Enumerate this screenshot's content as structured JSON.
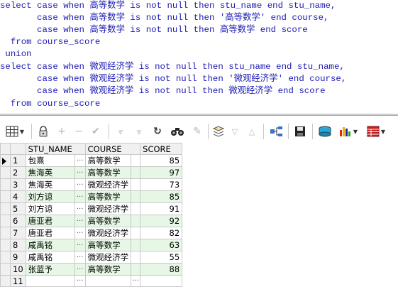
{
  "sql": {
    "lines": [
      [
        {
          "t": "select case when ",
          "c": "kw"
        },
        {
          "t": "高等数学",
          "c": "kw"
        },
        {
          "t": " is not null then ",
          "c": "kw"
        },
        {
          "t": "stu_name",
          "c": "kw"
        },
        {
          "t": " end ",
          "c": "kw"
        },
        {
          "t": "stu_name,",
          "c": "kw"
        }
      ],
      [
        {
          "t": "       case when ",
          "c": "kw"
        },
        {
          "t": "高等数学",
          "c": "kw"
        },
        {
          "t": " is not null then ",
          "c": "kw"
        },
        {
          "t": "'高等数学'",
          "c": "kw"
        },
        {
          "t": " end ",
          "c": "kw"
        },
        {
          "t": "course,",
          "c": "kw"
        }
      ],
      [
        {
          "t": "       case when ",
          "c": "kw"
        },
        {
          "t": "高等数学",
          "c": "kw"
        },
        {
          "t": " is not null then ",
          "c": "kw"
        },
        {
          "t": "高等数学",
          "c": "kw"
        },
        {
          "t": " end ",
          "c": "kw"
        },
        {
          "t": "score",
          "c": "kw"
        }
      ],
      [
        {
          "t": "  from ",
          "c": "kw"
        },
        {
          "t": "course_score",
          "c": "kw"
        }
      ],
      [
        {
          "t": " union",
          "c": "kw"
        }
      ],
      [
        {
          "t": "select case when ",
          "c": "kw"
        },
        {
          "t": "微观经济学",
          "c": "kw"
        },
        {
          "t": " is not null then ",
          "c": "kw"
        },
        {
          "t": "stu_name",
          "c": "kw"
        },
        {
          "t": " end ",
          "c": "kw"
        },
        {
          "t": "stu_name,",
          "c": "kw"
        }
      ],
      [
        {
          "t": "       case when ",
          "c": "kw"
        },
        {
          "t": "微观经济学",
          "c": "kw"
        },
        {
          "t": " is not null then ",
          "c": "kw"
        },
        {
          "t": "'微观经济学'",
          "c": "kw"
        },
        {
          "t": " end ",
          "c": "kw"
        },
        {
          "t": "course,",
          "c": "kw"
        }
      ],
      [
        {
          "t": "       case when ",
          "c": "kw"
        },
        {
          "t": "微观经济学",
          "c": "kw"
        },
        {
          "t": " is not null then ",
          "c": "kw"
        },
        {
          "t": "微观经济学",
          "c": "kw"
        },
        {
          "t": " end ",
          "c": "kw"
        },
        {
          "t": "score",
          "c": "kw"
        }
      ],
      [
        {
          "t": "  from ",
          "c": "kw"
        },
        {
          "t": "course_score",
          "c": "kw"
        }
      ]
    ]
  },
  "grid": {
    "columns": [
      "STU_NAME",
      "COURSE",
      "SCORE"
    ],
    "cell_button": "···",
    "rows": [
      {
        "n": "1",
        "name": "包熹",
        "course": "高等数学",
        "score": "85"
      },
      {
        "n": "2",
        "name": "焦海英",
        "course": "高等数学",
        "score": "97"
      },
      {
        "n": "3",
        "name": "焦海英",
        "course": "微观经济学",
        "score": "73"
      },
      {
        "n": "4",
        "name": "刘方谅",
        "course": "高等数学",
        "score": "85"
      },
      {
        "n": "5",
        "name": "刘方谅",
        "course": "微观经济学",
        "score": "91"
      },
      {
        "n": "6",
        "name": "唐亚君",
        "course": "高等数学",
        "score": "92"
      },
      {
        "n": "7",
        "name": "唐亚君",
        "course": "微观经济学",
        "score": "82"
      },
      {
        "n": "8",
        "name": "咸禹铭",
        "course": "高等数学",
        "score": "63"
      },
      {
        "n": "9",
        "name": "咸禹铭",
        "course": "微观经济学",
        "score": "55"
      },
      {
        "n": "10",
        "name": "张蓝予",
        "course": "高等数学",
        "score": "88"
      },
      {
        "n": "11",
        "name": "",
        "course": "",
        "score": ""
      }
    ]
  },
  "toolbar": {
    "icons": [
      "grid-view-icon",
      "lock-icon",
      "add-record-icon",
      "delete-record-icon",
      "post-changes-icon",
      "filter-icon",
      "clear-filter-icon",
      "refresh-icon",
      "find-icon",
      "clear-icon",
      "query-icon",
      "sort-asc-icon",
      "sort-desc-icon",
      "connect-icon",
      "save-icon",
      "export-icon",
      "chart-icon",
      "table-icon"
    ]
  },
  "colors": {
    "keyword": "#1a1ab4",
    "row_alt": "#e6f7e6",
    "header_bg": "#f0f0f0"
  }
}
